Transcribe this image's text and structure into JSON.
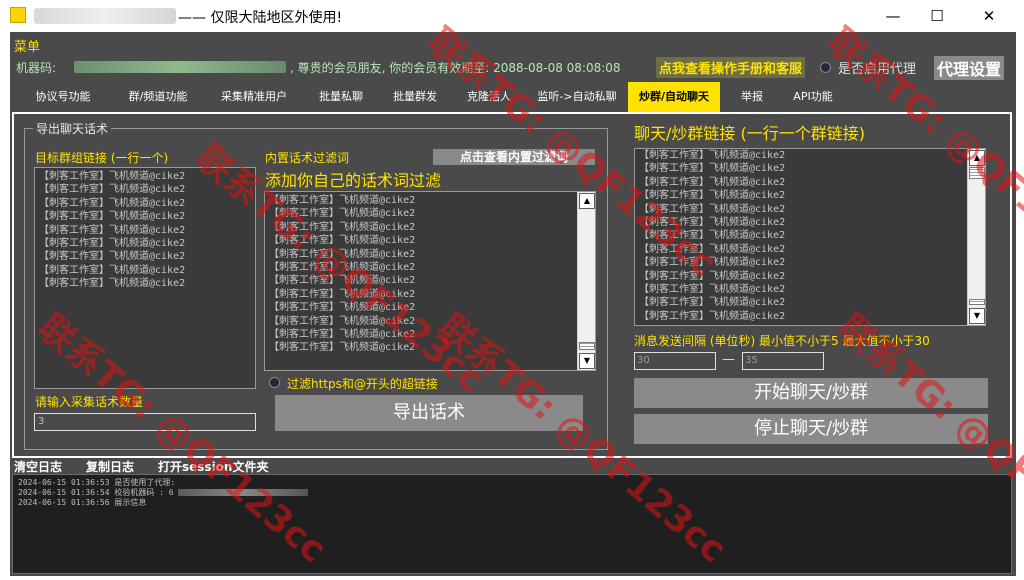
{
  "window": {
    "title": "—— 仅限大陆地区外使用!",
    "minimize_glyph": "—",
    "maximize_glyph": "☐",
    "close_glyph": "✕"
  },
  "menu": {
    "label": "菜单"
  },
  "info": {
    "machine_label": "机器码:",
    "member_text": ", 尊贵的会员朋友, 你的会员有效期至: 2088-08-08 08:08:08",
    "manual_button": "点我查看操作手册和客服",
    "proxy_label": "是否启用代理",
    "proxy_settings_button": "代理设置"
  },
  "tabs": [
    {
      "label": "协议号功能"
    },
    {
      "label": "群/频道功能"
    },
    {
      "label": "采集精准用户"
    },
    {
      "label": "批量私聊"
    },
    {
      "label": "批量群发"
    },
    {
      "label": "克隆活人"
    },
    {
      "label": "监听->自动私聊"
    },
    {
      "label": "炒群/自动聊天"
    },
    {
      "label": "举报"
    },
    {
      "label": "API功能"
    }
  ],
  "export_group": {
    "title": "导出聊天话术",
    "target_label": "目标群组链接 (一行一个)",
    "target_items": [
      "【刺客工作室】飞机频道@cike2",
      "【刺客工作室】飞机频道@cike2",
      "【刺客工作室】飞机频道@cike2",
      "【刺客工作室】飞机频道@cike2",
      "【刺客工作室】飞机频道@cike2",
      "【刺客工作室】飞机频道@cike2",
      "【刺客工作室】飞机频道@cike2",
      "【刺客工作室】飞机频道@cike2",
      "【刺客工作室】飞机频道@cike2"
    ],
    "builtin_label": "内置话术过滤词",
    "view_filter_button": "点击查看内置过滤词",
    "add_filter_label": "添加你自己的话术词过滤",
    "builtin_items": [
      "【刺客工作室】飞机频道@cike2",
      "【刺客工作室】飞机频道@cike2",
      "【刺客工作室】飞机频道@cike2",
      "【刺客工作室】飞机频道@cike2",
      "【刺客工作室】飞机频道@cike2",
      "【刺客工作室】飞机频道@cike2",
      "【刺客工作室】飞机频道@cike2",
      "【刺客工作室】飞机频道@cike2",
      "【刺客工作室】飞机频道@cike2",
      "【刺客工作室】飞机频道@cike2",
      "【刺客工作室】飞机频道@cike2",
      "【刺客工作室】飞机频道@cike2"
    ],
    "filter_links_label": "过滤https和@开头的超链接",
    "collect_count_label": "请输入采集话术数量",
    "collect_count_value": "3",
    "export_button": "导出话术"
  },
  "chat_group": {
    "links_label": "聊天/炒群链接 (一行一个群链接)",
    "link_items": [
      "【刺客工作室】飞机频道@cike2",
      "【刺客工作室】飞机频道@cike2",
      "【刺客工作室】飞机频道@cike2",
      "【刺客工作室】飞机频道@cike2",
      "【刺客工作室】飞机频道@cike2",
      "【刺客工作室】飞机频道@cike2",
      "【刺客工作室】飞机频道@cike2",
      "【刺客工作室】飞机频道@cike2",
      "【刺客工作室】飞机频道@cike2",
      "【刺客工作室】飞机频道@cike2",
      "【刺客工作室】飞机频道@cike2",
      "【刺客工作室】飞机频道@cike2",
      "【刺客工作室】飞机频道@cike2"
    ],
    "interval_label": "消息发送间隔 (单位秒) 最小值不小于5 最大值不小于30",
    "interval_min": "30",
    "interval_dash": "—",
    "interval_max": "35",
    "start_button": "开始聊天/炒群",
    "stop_button": "停止聊天/炒群"
  },
  "log": {
    "clear_button": "清空日志",
    "copy_button": "复制日志",
    "open_session_button": "打开session文件夹",
    "lines": [
      "2024-06-15 01:36:53 是否使用了代理:",
      "2024-06-15 01:36:54 校验机器码 : 6",
      "2024-06-15 01:36:56 展示信息"
    ]
  },
  "watermarks": [
    "联系TG: @QF123cc",
    "联系TG: @QF123cc",
    "联系TG: @QF123cc",
    "联系TG: @QF123cc",
    "联系TG: @QF123cc",
    "联系TG: @QF123cc"
  ],
  "colors": {
    "accent": "#ffe200",
    "panel_bg": "#4a4a4a",
    "button_bg": "#8a8a8a",
    "watermark": "#dc1414"
  }
}
